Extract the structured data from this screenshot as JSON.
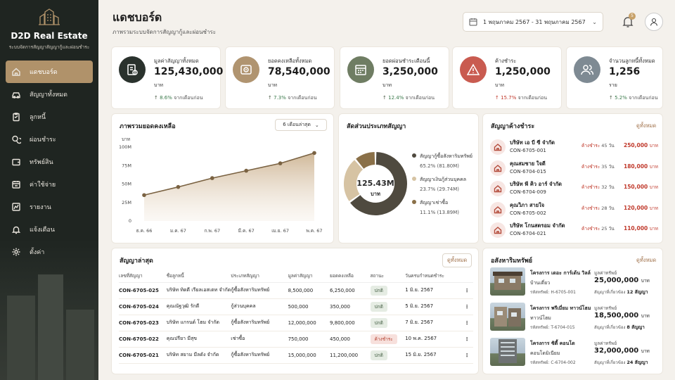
{
  "sidebar": {
    "brand": "D2D Real Estate",
    "brand_sub": "ระบบจัดการสัญญาสัญญากู้และผ่อนชำระ",
    "items": [
      {
        "label": "แดชบอร์ด",
        "icon": "home-icon",
        "active": true
      },
      {
        "label": "สัญญาทั้งหมด",
        "icon": "car-icon"
      },
      {
        "label": "ลูกหนี้",
        "icon": "clipboard-icon"
      },
      {
        "label": "ผ่อนชำระ",
        "icon": "coins-icon"
      },
      {
        "label": "ทรัพย์สิน",
        "icon": "wallet-icon"
      },
      {
        "label": "ค่าใช้จ่าย",
        "icon": "calendar-icon"
      },
      {
        "label": "รายงาน",
        "icon": "chart-icon"
      },
      {
        "label": "แจ้งเตือน",
        "icon": "bell-icon"
      },
      {
        "label": "ตั้งค่า",
        "icon": "gear-icon"
      }
    ]
  },
  "header": {
    "title": "แดชบอร์ด",
    "subtitle": "ภาพรวมระบบจัดการสัญญากู้และผ่อนชำระ",
    "date_range": "1 พฤษภาคม 2567 - 31 พฤษภาคม 2567",
    "notification_count": "5"
  },
  "stats": [
    {
      "label": "มูลค่าสัญญาทั้งหมด",
      "value": "125,430,000",
      "unit": "บาท",
      "pct": "8.6%",
      "suffix": "จากเดือนก่อน",
      "color": "#2a322d"
    },
    {
      "label": "ยอดคงเหลือทั้งหมด",
      "value": "78,540,000",
      "unit": "บาท",
      "pct": "7.3%",
      "suffix": "จากเดือนก่อน",
      "color": "#b09470"
    },
    {
      "label": "ยอดผ่อนชำระเดือนนี้",
      "value": "3,250,000",
      "unit": "บาท",
      "pct": "12.4%",
      "suffix": "จากเดือนก่อน",
      "color": "#6f7d63"
    },
    {
      "label": "ค้างชำระ",
      "value": "1,250,000",
      "unit": "บาท",
      "pct": "15.7%",
      "suffix": "จากเดือนก่อน",
      "color": "#c95b50"
    },
    {
      "label": "จำนวนลูกหนี้ทั้งหมด",
      "value": "1,256",
      "unit": "ราย",
      "pct": "5.2%",
      "suffix": "จากเดือนก่อน",
      "color": "#7e8a93"
    }
  ],
  "balance_chart": {
    "title": "ภาพรวมยอดคงเหลือ",
    "range_select": "6 เดือนล่าสุด"
  },
  "chart_data": [
    {
      "type": "area",
      "title": "ภาพรวมยอดคงเหลือ",
      "ylabel": "บาท",
      "x": [
        "ธ.ค. 66",
        "ม.ค. 67",
        "ก.พ. 67",
        "มี.ค. 67",
        "เม.ย. 67",
        "พ.ค. 67"
      ],
      "y_ticks": [
        "100M",
        "75M",
        "50M",
        "25M",
        "0"
      ],
      "values": [
        35,
        46,
        58,
        68,
        78,
        92
      ],
      "ylim": [
        0,
        100
      ],
      "color": "#7a6242"
    },
    {
      "type": "pie",
      "title": "สัดส่วนประเภทสัญญา",
      "center_value": "125.43M",
      "center_unit": "บาท",
      "series": [
        {
          "name": "สัญญากู้ซื้อสังหาริมทรัพย์",
          "pct": "65.2%",
          "amount": "(81.80M)",
          "value": 65.2,
          "color": "#4f4a3f"
        },
        {
          "name": "สัญญาเงินกู้ส่วนบุคคล",
          "pct": "23.7%",
          "amount": "(29.74M)",
          "value": 23.7,
          "color": "#d6c3a3"
        },
        {
          "name": "สัญญาเช่าซื้อ",
          "pct": "11.1%",
          "amount": "(13.89M)",
          "value": 11.1,
          "color": "#8a7048"
        }
      ]
    }
  ],
  "overdue": {
    "title": "สัญญาค้างชำระ",
    "view_all": "ดูทั้งหมด",
    "days_label": "ค้างชำระ",
    "items": [
      {
        "name": "บริษัท เอ บี ซี จำกัด",
        "code": "CON-6705-001",
        "days": "45 วัน",
        "amount": "250,000",
        "unit": "บาท"
      },
      {
        "name": "คุณสมชาย ใจดี",
        "code": "CON-6704-015",
        "days": "35 วัน",
        "amount": "180,000",
        "unit": "บาท"
      },
      {
        "name": "บริษัท พี คิว อาร์ จำกัด",
        "code": "CON-6704-009",
        "days": "32 วัน",
        "amount": "150,000",
        "unit": "บาท"
      },
      {
        "name": "คุณวิภา สายใจ",
        "code": "CON-6705-002",
        "days": "28 วัน",
        "amount": "120,000",
        "unit": "บาท"
      },
      {
        "name": "บริษัท โกนสตรอม จำกัด",
        "code": "CON-6704-021",
        "days": "25 วัน",
        "amount": "110,000",
        "unit": "บาท"
      }
    ]
  },
  "recent": {
    "title": "สัญญาล่าสุด",
    "view_all": "ดูทั้งหมด",
    "columns": [
      "เลขที่สัญญา",
      "ชื่อลูกหนี้",
      "ประเภทสัญญา",
      "มูลค่าสัญญา",
      "ยอดคงเหลือ",
      "สถานะ",
      "วันครบกำหนดชำระ"
    ],
    "rows": [
      {
        "code": "CON-6705-025",
        "name": "บริษัท ทิดดี เรียลเอสเตท จำกัด",
        "type": "กู้ซื้อสังหาริมทรัพย์",
        "value": "8,500,000",
        "balance": "6,250,000",
        "status": "ปกติ",
        "status_kind": "normal",
        "due": "1 มิ.ย. 2567"
      },
      {
        "code": "CON-6705-024",
        "name": "คุณณัฐวุฒิ รักดี",
        "type": "กู้ส่วนบุคคล",
        "value": "500,000",
        "balance": "350,000",
        "status": "ปกติ",
        "status_kind": "normal",
        "due": "5 มิ.ย. 2567"
      },
      {
        "code": "CON-6705-023",
        "name": "บริษัท แกรนด์ โฮม จำกัด",
        "type": "กู้ซื้อสังหาริมทรัพย์",
        "value": "12,000,000",
        "balance": "9,800,000",
        "status": "ปกติ",
        "status_kind": "normal",
        "due": "7 มิ.ย. 2567"
      },
      {
        "code": "CON-6705-022",
        "name": "คุณปรียา มีสุข",
        "type": "เช่าซื้อ",
        "value": "750,000",
        "balance": "450,000",
        "status": "ค้างชำระ",
        "status_kind": "overdue",
        "due": "10 พ.ค. 2567"
      },
      {
        "code": "CON-6705-021",
        "name": "บริษัท สยาม มีลดัง จำกัด",
        "type": "กู้ซื้อสังหาริมทรัพย์",
        "value": "15,000,000",
        "balance": "11,200,000",
        "status": "ปกติ",
        "status_kind": "normal",
        "due": "15 มิ.ย. 2567"
      }
    ]
  },
  "assets": {
    "title": "อสังหาริมทรัพย์",
    "view_all": "ดูทั้งหมด",
    "value_label": "มูลค่าทรัพย์",
    "items": [
      {
        "name": "โครงการ เดอะ การ์เด้น วิลล์",
        "type": "บ้านเดี่ยว",
        "code": "รหัสทรัพย์: H-6705-001",
        "value": "25,000,000",
        "unit": "บาท",
        "exp_label": "สัญญาที่เกี่ยวข้อง",
        "exp_count": "12 สัญญา"
      },
      {
        "name": "โครงการ พรีเมี่ยม ทาวน์โฮม",
        "type": "ทาวน์โฮม",
        "code": "รหัสทรัพย์: T-6704-015",
        "value": "18,500,000",
        "unit": "บาท",
        "exp_label": "สัญญาที่เกี่ยวข้อง",
        "exp_count": "8 สัญญา"
      },
      {
        "name": "โครงการ ซิตี้ คอนโด",
        "type": "คอนโดมิเนียม",
        "code": "รหัสทรัพย์: C-6704-002",
        "value": "32,000,000",
        "unit": "บาท",
        "exp_label": "สัญญาที่เกี่ยวข้อง",
        "exp_count": "24 สัญญา"
      }
    ]
  }
}
